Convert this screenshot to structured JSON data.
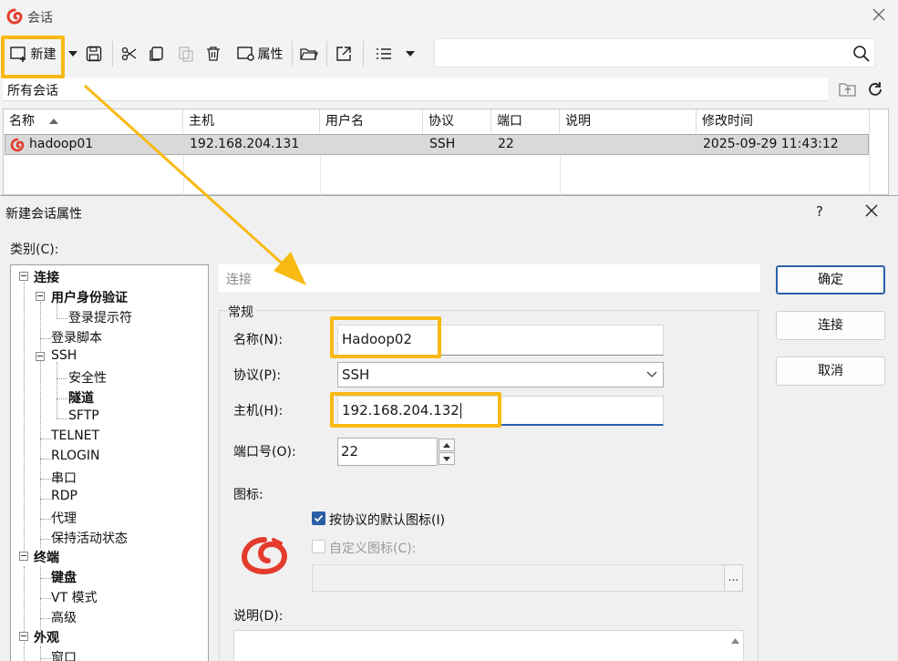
{
  "window": {
    "title": "会话"
  },
  "toolbar": {
    "new_label": "新建",
    "properties_label": "属性",
    "search": {
      "value": "",
      "placeholder": ""
    }
  },
  "session_bar": {
    "path": "所有会话"
  },
  "session_table": {
    "columns": [
      "名称",
      "主机",
      "用户名",
      "协议",
      "端口",
      "说明",
      "修改时间"
    ],
    "rows": [
      {
        "name": "hadoop01",
        "host": "192.168.204.131",
        "user": "",
        "protocol": "SSH",
        "port": "22",
        "desc": "",
        "modified": "2025-09-29 11:43:12"
      }
    ]
  },
  "dialog": {
    "title": "新建会话属性",
    "help": "?",
    "category_label": "类别(C):",
    "tree": [
      {
        "label": "连接",
        "bold": true
      },
      {
        "label": "用户身份验证",
        "bold": true
      },
      {
        "label": "登录提示符",
        "bold": false
      },
      {
        "label": "登录脚本",
        "bold": false
      },
      {
        "label": "SSH",
        "bold": false
      },
      {
        "label": "安全性",
        "bold": false
      },
      {
        "label": "隧道",
        "bold": true
      },
      {
        "label": "SFTP",
        "bold": false
      },
      {
        "label": "TELNET",
        "bold": false
      },
      {
        "label": "RLOGIN",
        "bold": false
      },
      {
        "label": "串口",
        "bold": false
      },
      {
        "label": "RDP",
        "bold": false
      },
      {
        "label": "代理",
        "bold": false
      },
      {
        "label": "保持活动状态",
        "bold": false
      },
      {
        "label": "终端",
        "bold": true
      },
      {
        "label": "键盘",
        "bold": true
      },
      {
        "label": "VT 模式",
        "bold": false
      },
      {
        "label": "高级",
        "bold": false
      },
      {
        "label": "外观",
        "bold": true
      },
      {
        "label": "窗口",
        "bold": false
      }
    ],
    "panel_header": "连接",
    "general_label": "常规",
    "name_label": "名称(N):",
    "name_value": "Hadoop02",
    "protocol_label": "协议(P):",
    "protocol_value": "SSH",
    "host_label": "主机(H):",
    "host_value": "192.168.204.132",
    "port_label": "端口号(O):",
    "port_value": "22",
    "icon_label": "图标:",
    "default_icon_label": "按协议的默认图标(I)",
    "default_icon_checked": true,
    "custom_icon_label": "自定义图标(C):",
    "custom_icon_checked": false,
    "custom_icon_path": "",
    "browse_label": "...",
    "description_label": "说明(D):",
    "description_value": "",
    "buttons": {
      "ok": "确定",
      "connect": "连接",
      "cancel": "取消"
    }
  },
  "colors": {
    "highlight": "#f8b912",
    "accent": "#2a5fa8",
    "brand_red": "#e53b2c"
  }
}
